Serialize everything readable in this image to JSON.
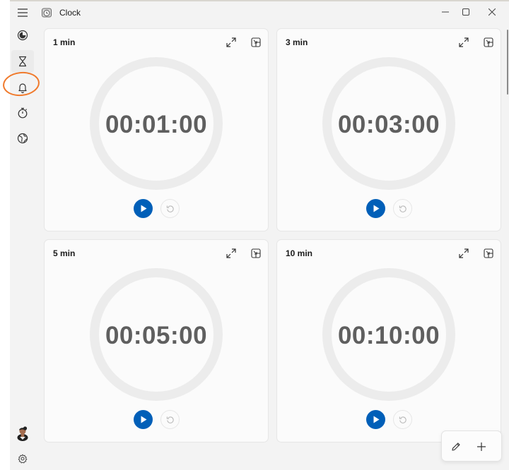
{
  "window": {
    "title": "Clock",
    "icon": "clock-app-icon",
    "controls": [
      "minimize-icon",
      "maximize-icon",
      "close-icon"
    ]
  },
  "nav": {
    "menu_icon": "hamburger-menu-icon",
    "items": [
      {
        "name": "focus-sessions",
        "icon": "focus-icon",
        "active": false
      },
      {
        "name": "timer",
        "icon": "hourglass-icon",
        "active": true
      },
      {
        "name": "alarm",
        "icon": "bell-icon",
        "active": false
      },
      {
        "name": "stopwatch",
        "icon": "stopwatch-icon",
        "active": false
      },
      {
        "name": "world-clock",
        "icon": "globe-icon",
        "active": false
      }
    ],
    "bottom": [
      {
        "name": "account",
        "icon": "avatar"
      },
      {
        "name": "settings",
        "icon": "gear-icon"
      }
    ],
    "highlight_color": "#f07a2c"
  },
  "timers": [
    {
      "label": "1 min",
      "time": "00:01:00"
    },
    {
      "label": "3 min",
      "time": "00:03:00"
    },
    {
      "label": "5 min",
      "time": "00:05:00"
    },
    {
      "label": "10 min",
      "time": "00:10:00"
    }
  ],
  "colors": {
    "accent": "#005fb8",
    "ring": "#ececec",
    "time_text": "#5f5f5f"
  },
  "fab": {
    "edit_icon": "pencil-icon",
    "add_icon": "plus-icon"
  }
}
